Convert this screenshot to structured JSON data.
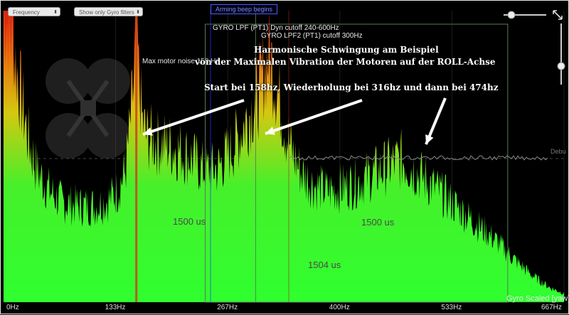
{
  "controls": {
    "spectrum_type_select": "Frequency",
    "gyro_filter_select": "Show only Gyro filters",
    "arming_label": "Arming beep begins"
  },
  "overlay_labels": {
    "gyro_lpf1": "GYRO LPF (PT1) Dyn cutoff 240-600Hz",
    "gyro_lpf2": "GYRO LPF2 (PT1) cutoff 300Hz",
    "max_motor_noise": "Max motor noise 158 Hz",
    "debug_label": "Debu",
    "series_label": "Gyro Scaled [yaw]"
  },
  "annotation": {
    "title_line1": "Harmonische Schwingung am Beispiel",
    "title_line2": "von der Maximalen Vibration der Motoren auf der ROLL-Achse",
    "detail_line": "Start bei 158hz, Wiederholung bei 316hz und dann bei 474hz"
  },
  "background_text": {
    "t1": "1500 us",
    "t2": "1500 us",
    "t3": "1504 us"
  },
  "chart_data": {
    "type": "area",
    "title": "",
    "xlabel": "",
    "ylabel": "",
    "x_ticks": [
      "0Hz",
      "133Hz",
      "267Hz",
      "400Hz",
      "533Hz",
      "667Hz"
    ],
    "xlim": [
      0,
      667
    ],
    "series": [
      {
        "name": "Gyro Scaled [yaw]",
        "x": [
          0,
          10,
          20,
          30,
          40,
          55,
          70,
          90,
          110,
          125,
          135,
          145,
          150,
          155,
          158,
          161,
          165,
          170,
          180,
          195,
          210,
          225,
          240,
          255,
          265,
          275,
          285,
          295,
          305,
          310,
          316,
          322,
          328,
          335,
          345,
          355,
          370,
          385,
          400,
          420,
          440,
          460,
          474,
          490,
          510,
          530,
          550,
          570,
          590,
          610,
          630,
          650,
          667
        ],
        "values": [
          100,
          90,
          72,
          55,
          45,
          38,
          34,
          33,
          33,
          35,
          38,
          45,
          58,
          75,
          95,
          78,
          62,
          57,
          55,
          54,
          52,
          49,
          45,
          46,
          50,
          54,
          60,
          66,
          73,
          80,
          86,
          78,
          70,
          60,
          50,
          44,
          40,
          38,
          39,
          41,
          44,
          47,
          49,
          45,
          40,
          35,
          30,
          25,
          20,
          14,
          9,
          5,
          3
        ]
      }
    ],
    "ylim": [
      0,
      100
    ],
    "markers": [
      {
        "label": "Max motor noise 158 Hz",
        "x": 158,
        "color": "#c84a1f"
      },
      {
        "label": "GYRO LPF2 (PT1) cutoff 300Hz",
        "x": 300,
        "color": "#5a7a5a"
      },
      {
        "label": "GYRO LPF (PT1) Dyn cutoff 240-600Hz",
        "x_range": [
          240,
          600
        ],
        "color": "#5a7a5a"
      }
    ],
    "harmonics_hz": [
      158,
      316,
      474
    ],
    "grid": true,
    "colors": {
      "low": "#39ff2b",
      "high": "#ff3a1a",
      "mid": "#d8d417"
    }
  }
}
